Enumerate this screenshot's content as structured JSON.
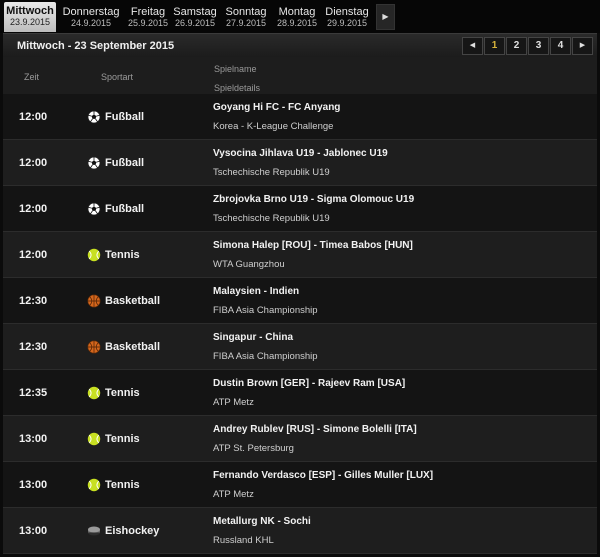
{
  "day_tabs": [
    {
      "day": "Mittwoch",
      "date": "23.9.2015",
      "active": true
    },
    {
      "day": "Donnerstag",
      "date": "24.9.2015",
      "active": false
    },
    {
      "day": "Freitag",
      "date": "25.9.2015",
      "active": false
    },
    {
      "day": "Samstag",
      "date": "26.9.2015",
      "active": false
    },
    {
      "day": "Sonntag",
      "date": "27.9.2015",
      "active": false
    },
    {
      "day": "Montag",
      "date": "28.9.2015",
      "active": false
    },
    {
      "day": "Dienstag",
      "date": "29.9.2015",
      "active": false
    }
  ],
  "tabs_next_icon": "triangle-right-icon",
  "header": {
    "title": "Mittwoch - 23 September 2015",
    "pager": {
      "prev_icon": "triangle-left-icon",
      "pages": [
        "1",
        "2",
        "3",
        "4"
      ],
      "current_page": "1",
      "next_icon": "triangle-right-icon"
    }
  },
  "columns": {
    "zeit": "Zeit",
    "sportart": "Sportart",
    "spielname": "Spielname",
    "spieldetails": "Spieldetails"
  },
  "sport_colors": {
    "Fußball": "#ffffff",
    "Tennis": "#c8e021",
    "Basketball": "#d4661c",
    "Eishockey": "#6a6a6a"
  },
  "events": [
    {
      "time": "12:00",
      "sport": "Fußball",
      "icon": "soccer-ball-icon",
      "match": "Goyang Hi FC - FC Anyang",
      "competition": "Korea - K-League Challenge"
    },
    {
      "time": "12:00",
      "sport": "Fußball",
      "icon": "soccer-ball-icon",
      "match": "Vysocina Jihlava U19 - Jablonec U19",
      "competition": "Tschechische Republik U19"
    },
    {
      "time": "12:00",
      "sport": "Fußball",
      "icon": "soccer-ball-icon",
      "match": "Zbrojovka Brno U19 - Sigma Olomouc U19",
      "competition": "Tschechische Republik U19"
    },
    {
      "time": "12:00",
      "sport": "Tennis",
      "icon": "tennis-ball-icon",
      "match": "Simona Halep [ROU] - Timea Babos [HUN]",
      "competition": "WTA Guangzhou"
    },
    {
      "time": "12:30",
      "sport": "Basketball",
      "icon": "basketball-icon",
      "match": "Malaysien - Indien",
      "competition": "FIBA Asia Championship"
    },
    {
      "time": "12:30",
      "sport": "Basketball",
      "icon": "basketball-icon",
      "match": "Singapur - China",
      "competition": "FIBA Asia Championship"
    },
    {
      "time": "12:35",
      "sport": "Tennis",
      "icon": "tennis-ball-icon",
      "match": "Dustin Brown [GER] - Rajeev Ram [USA]",
      "competition": "ATP Metz"
    },
    {
      "time": "13:00",
      "sport": "Tennis",
      "icon": "tennis-ball-icon",
      "match": "Andrey Rublev [RUS] - Simone Bolelli [ITA]",
      "competition": "ATP St. Petersburg"
    },
    {
      "time": "13:00",
      "sport": "Tennis",
      "icon": "tennis-ball-icon",
      "match": "Fernando Verdasco [ESP] - Gilles Muller [LUX]",
      "competition": "ATP Metz"
    },
    {
      "time": "13:00",
      "sport": "Eishockey",
      "icon": "hockey-puck-icon",
      "match": "Metallurg NK - Sochi",
      "competition": "Russland KHL"
    }
  ]
}
